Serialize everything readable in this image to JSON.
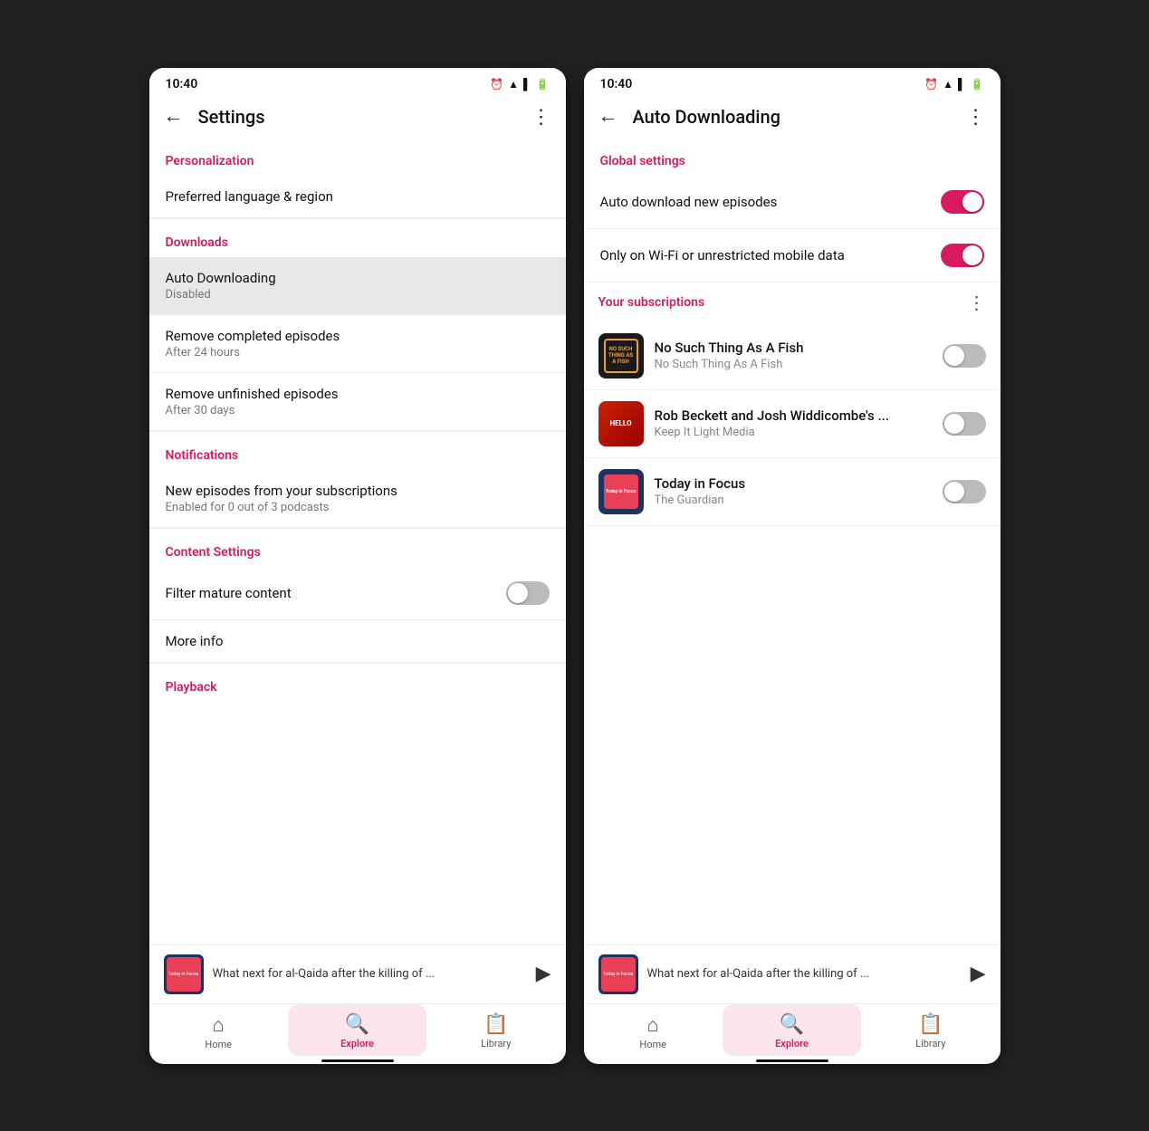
{
  "screen1": {
    "status_time": "10:40",
    "title": "Settings",
    "sections": [
      {
        "header": "Personalization",
        "items": [
          {
            "title": "Preferred language & region",
            "subtitle": null
          }
        ]
      },
      {
        "header": "Downloads",
        "items": [
          {
            "title": "Auto Downloading",
            "subtitle": "Disabled",
            "selected": true
          },
          {
            "title": "Remove completed episodes",
            "subtitle": "After 24 hours",
            "selected": false
          },
          {
            "title": "Remove unfinished episodes",
            "subtitle": "After 30 days",
            "selected": false
          }
        ]
      },
      {
        "header": "Notifications",
        "items": [
          {
            "title": "New episodes from your subscriptions",
            "subtitle": "Enabled for 0 out of 3 podcasts"
          }
        ]
      },
      {
        "header": "Content Settings",
        "items": [
          {
            "title": "Filter mature content",
            "hasToggle": true,
            "toggleOn": false
          },
          {
            "title": "More info",
            "subtitle": null
          }
        ]
      },
      {
        "header": "Playback",
        "items": []
      }
    ],
    "player": {
      "text": "What next for al-Qaida after the killing of ..."
    },
    "nav": {
      "items": [
        {
          "icon": "🏠",
          "label": "Home",
          "active": false
        },
        {
          "icon": "🔍",
          "label": "Explore",
          "active": true
        },
        {
          "icon": "📋",
          "label": "Library",
          "active": false
        }
      ]
    }
  },
  "screen2": {
    "status_time": "10:40",
    "title": "Auto Downloading",
    "global_settings_header": "Global settings",
    "toggle_rows": [
      {
        "label": "Auto download new episodes",
        "on": true
      },
      {
        "label": "Only on Wi-Fi or unrestricted mobile data",
        "on": true
      }
    ],
    "subscriptions_header": "Your subscriptions",
    "subscriptions": [
      {
        "title": "No Such Thing As A Fish",
        "subtitle": "No Such Thing As A Fish",
        "thumb_type": "fish",
        "toggle_on": false
      },
      {
        "title": "Rob Beckett and Josh Widdicombe's ...",
        "subtitle": "Keep It Light Media",
        "thumb_type": "rob",
        "toggle_on": false
      },
      {
        "title": "Today in Focus",
        "subtitle": "The Guardian",
        "thumb_type": "guardian",
        "toggle_on": false
      }
    ],
    "player": {
      "text": "What next for al-Qaida after the killing of ..."
    },
    "nav": {
      "items": [
        {
          "icon": "🏠",
          "label": "Home",
          "active": false
        },
        {
          "icon": "🔍",
          "label": "Explore",
          "active": true
        },
        {
          "icon": "📋",
          "label": "Library",
          "active": false
        }
      ]
    }
  }
}
